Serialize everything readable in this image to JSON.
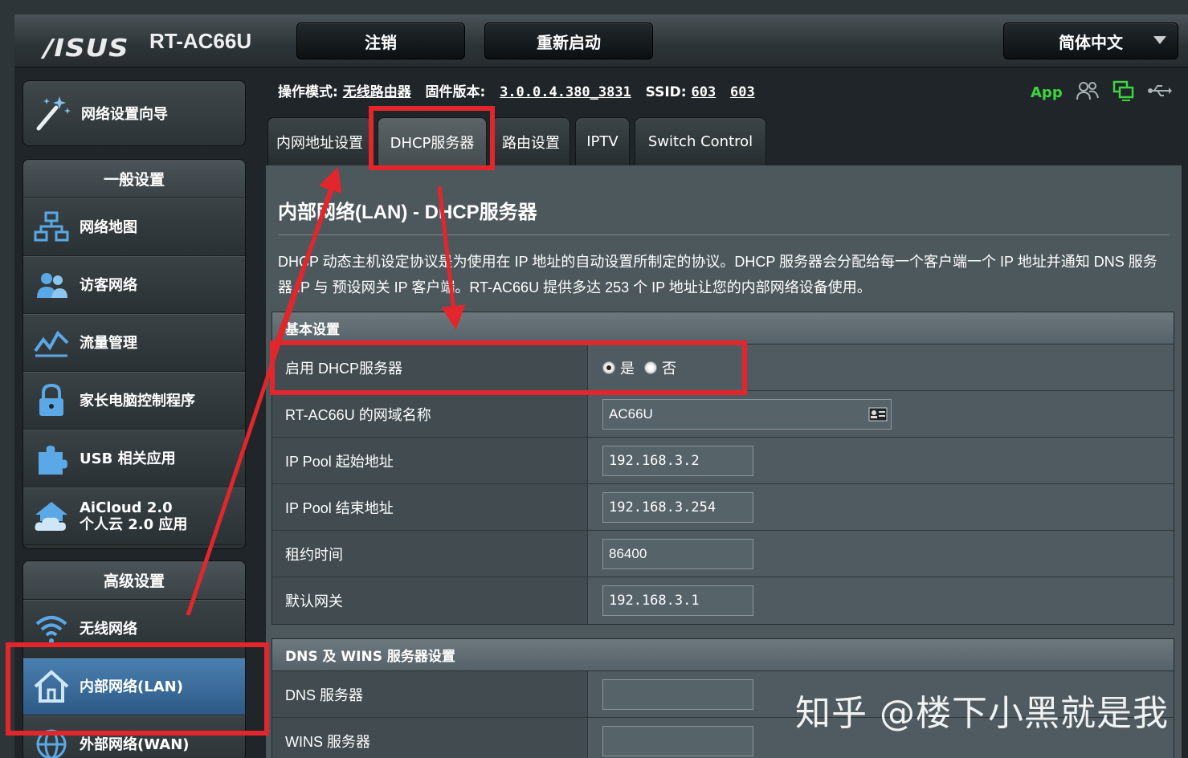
{
  "header": {
    "brand": "/ISUS",
    "model": "RT-AC66U",
    "logout_label": "注销",
    "reboot_label": "重新启动",
    "language_label": "简体中文"
  },
  "status": {
    "mode_label": "操作模式:",
    "mode_value": "无线路由器",
    "firmware_label": "固件版本:",
    "firmware_value": "3.0.0.4.380_3831",
    "ssid_label": "SSID:",
    "ssid_1": "603",
    "ssid_2": "603",
    "app_label": "App"
  },
  "sidebar": {
    "wizard_label": "网络设置向导",
    "general_header": "一般设置",
    "general_items": [
      {
        "label": "网络地图",
        "icon": "network-map-icon"
      },
      {
        "label": "访客网络",
        "icon": "guest-network-icon"
      },
      {
        "label": "流量管理",
        "icon": "traffic-manager-icon"
      },
      {
        "label": "家长电脑控制程序",
        "icon": "parental-lock-icon"
      },
      {
        "label": "USB 相关应用",
        "icon": "usb-puzzle-icon"
      },
      {
        "label": "AiCloud 2.0",
        "label2": "个人云 2.0 应用",
        "icon": "aicloud-icon"
      }
    ],
    "advanced_header": "高级设置",
    "advanced_items": [
      {
        "label": "无线网络",
        "icon": "wireless-icon"
      },
      {
        "label": "内部网络(LAN)",
        "icon": "home-icon"
      },
      {
        "label": "外部网络(WAN)",
        "icon": "globe-icon"
      }
    ]
  },
  "tabs": [
    {
      "label": "内网地址设置"
    },
    {
      "label": "DHCP服务器"
    },
    {
      "label": "路由设置"
    },
    {
      "label": "IPTV"
    },
    {
      "label": "Switch Control"
    }
  ],
  "main": {
    "title": "内部网络(LAN) - DHCP服务器",
    "description": "DHCP 动态主机设定协议是为使用在 IP 地址的自动设置所制定的协议。DHCP 服务器会分配给每一个客户端一个 IP 地址并通知 DNS 服务器 IP 与 预设网关 IP 客户端。RT-AC66U 提供多达 253 个 IP 地址让您的内部网络设备使用。"
  },
  "basic": {
    "header": "基本设置",
    "enable_label": "启用 DHCP服务器",
    "yes_label": "是",
    "no_label": "否",
    "enabled": true,
    "domain_label": "RT-AC66U 的网域名称",
    "domain_value": "AC66U",
    "pool_start_label": "IP Pool 起始地址",
    "pool_start_value": "192.168.3.2",
    "pool_end_label": "IP Pool 结束地址",
    "pool_end_value": "192.168.3.254",
    "lease_label": "租约时间",
    "lease_value": "86400",
    "gateway_label": "默认网关",
    "gateway_value": "192.168.3.1"
  },
  "dns": {
    "header": "DNS 及 WINS 服务器设置",
    "dns_label": "DNS 服务器",
    "dns_value": "",
    "wins_label": "WINS 服务器",
    "wins_value": ""
  },
  "watermark": "知乎 @楼下小黑就是我",
  "colors": {
    "annotation_red": "#e3262b",
    "app_green": "#3fd43f",
    "active_blue": "#3a6e9e"
  }
}
